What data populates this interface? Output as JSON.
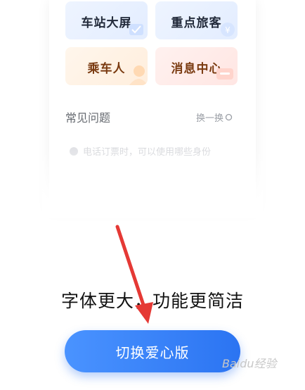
{
  "tiles": [
    {
      "label": "车站大屏"
    },
    {
      "label": "重点旅客"
    },
    {
      "label": "乘车人"
    },
    {
      "label": "消息中心"
    }
  ],
  "faq": {
    "title": "常见问题",
    "refresh_label": "换一换",
    "question": "电话订票时，可以使用哪些身份"
  },
  "promo": {
    "headline": "字体更大，功能更简洁",
    "button_label": "切换爱心版"
  },
  "watermark": "Baidu经验",
  "colors": {
    "accent": "#2b74f2",
    "arrow": "#e53935"
  }
}
